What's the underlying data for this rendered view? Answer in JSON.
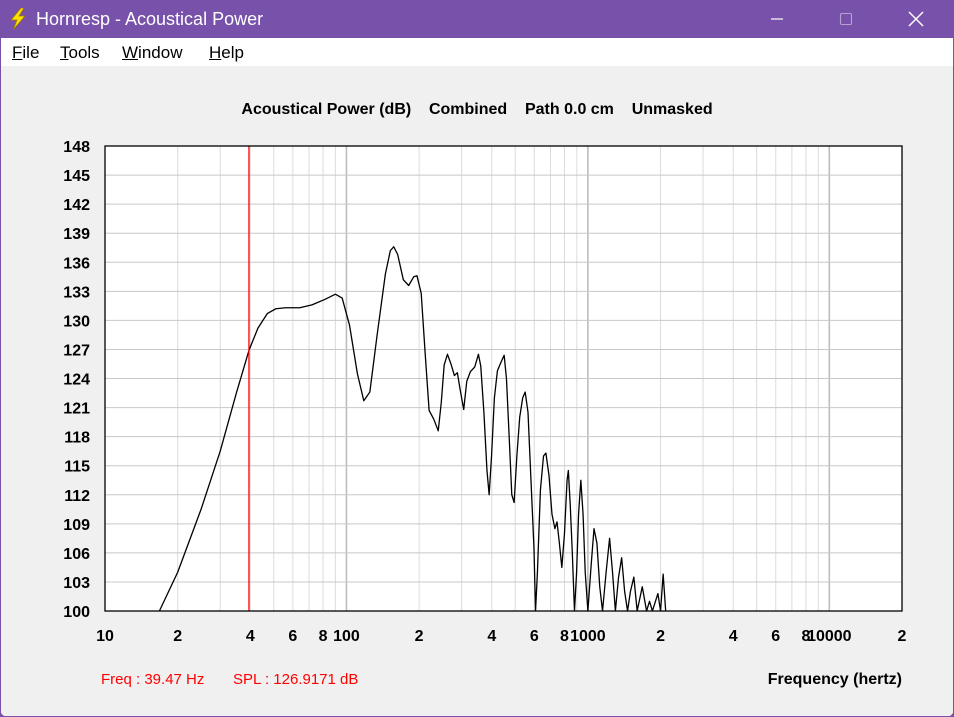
{
  "window": {
    "title": "Hornresp - Acoustical Power",
    "icon": "lightning-bolt-icon",
    "controls": [
      "minimize-icon",
      "maximize-icon",
      "close-icon"
    ]
  },
  "menu": [
    {
      "underline": "F",
      "rest": "ile"
    },
    {
      "underline": "T",
      "rest": "ools"
    },
    {
      "underline": "W",
      "rest": "indow"
    },
    {
      "underline": "H",
      "rest": "elp"
    }
  ],
  "chart_data": {
    "type": "line",
    "title": "Acoustical Power (dB)    Combined    Path 0.0 cm    Unmasked",
    "xlabel": "Frequency (hertz)",
    "ylabel": "",
    "xscale": "log",
    "xlim": [
      10,
      20000
    ],
    "ylim": [
      100,
      148
    ],
    "yticks": [
      148,
      145,
      142,
      139,
      136,
      133,
      130,
      127,
      124,
      121,
      118,
      115,
      112,
      109,
      106,
      103,
      100
    ],
    "xtick_labels": [
      {
        "v": 10,
        "t": "10"
      },
      {
        "v": 20,
        "t": "2"
      },
      {
        "v": 40,
        "t": "4"
      },
      {
        "v": 60,
        "t": "6"
      },
      {
        "v": 80,
        "t": "8"
      },
      {
        "v": 100,
        "t": "100"
      },
      {
        "v": 200,
        "t": "2"
      },
      {
        "v": 400,
        "t": "4"
      },
      {
        "v": 600,
        "t": "6"
      },
      {
        "v": 800,
        "t": "8"
      },
      {
        "v": 1000,
        "t": "1000"
      },
      {
        "v": 2000,
        "t": "2"
      },
      {
        "v": 4000,
        "t": "4"
      },
      {
        "v": 6000,
        "t": "6"
      },
      {
        "v": 8000,
        "t": "8"
      },
      {
        "v": 10000,
        "t": "10000"
      },
      {
        "v": 20000,
        "t": "2"
      }
    ],
    "grid": true,
    "cursor": {
      "freq": 39.47,
      "freq_label": "Freq : 39.47 Hz",
      "spl_label": "SPL : 126.9171 dB",
      "color": "#ff0000"
    },
    "series": [
      {
        "color": "#000000",
        "points": [
          [
            16.8,
            100
          ],
          [
            20,
            104
          ],
          [
            25,
            110.5
          ],
          [
            30,
            116.5
          ],
          [
            35,
            122.5
          ],
          [
            39.47,
            126.9
          ],
          [
            43,
            129.2
          ],
          [
            47,
            130.7
          ],
          [
            51,
            131.2
          ],
          [
            56,
            131.3
          ],
          [
            64,
            131.3
          ],
          [
            72,
            131.6
          ],
          [
            82,
            132.2
          ],
          [
            90,
            132.7
          ],
          [
            96,
            132.3
          ],
          [
            103,
            129.5
          ],
          [
            111,
            124.5
          ],
          [
            118,
            121.7
          ],
          [
            125,
            122.6
          ],
          [
            134,
            128.5
          ],
          [
            145,
            134.8
          ],
          [
            152,
            137.2
          ],
          [
            157,
            137.6
          ],
          [
            163,
            136.8
          ],
          [
            172,
            134.2
          ],
          [
            181,
            133.6
          ],
          [
            190,
            134.5
          ],
          [
            196,
            134.6
          ],
          [
            204,
            132.8
          ],
          [
            212,
            126.5
          ],
          [
            220,
            120.7
          ],
          [
            230,
            119.8
          ],
          [
            240,
            118.6
          ],
          [
            247,
            121.5
          ],
          [
            254,
            125.4
          ],
          [
            262,
            126.5
          ],
          [
            271,
            125.5
          ],
          [
            280,
            124.3
          ],
          [
            288,
            124.6
          ],
          [
            296,
            122.8
          ],
          [
            306,
            120.8
          ],
          [
            315,
            123.7
          ],
          [
            326,
            124.7
          ],
          [
            340,
            125.2
          ],
          [
            352,
            126.5
          ],
          [
            360,
            125.3
          ],
          [
            371,
            120.5
          ],
          [
            382,
            114.5
          ],
          [
            390,
            112.0
          ],
          [
            399,
            116.0
          ],
          [
            410,
            122.0
          ],
          [
            422,
            124.8
          ],
          [
            437,
            125.7
          ],
          [
            450,
            126.4
          ],
          [
            460,
            124.0
          ],
          [
            472,
            118.0
          ],
          [
            484,
            112.0
          ],
          [
            495,
            111.2
          ],
          [
            508,
            116.0
          ],
          [
            522,
            120.0
          ],
          [
            537,
            122.0
          ],
          [
            550,
            122.6
          ],
          [
            565,
            120.5
          ],
          [
            580,
            114.0
          ],
          [
            598,
            106.5
          ],
          [
            607,
            100
          ],
          [
            618,
            104.0
          ],
          [
            636,
            112.5
          ],
          [
            655,
            116.0
          ],
          [
            670,
            116.3
          ],
          [
            690,
            114.0
          ],
          [
            710,
            110.0
          ],
          [
            730,
            108.5
          ],
          [
            745,
            109.2
          ],
          [
            762,
            107.0
          ],
          [
            780,
            104.5
          ],
          [
            800,
            108.0
          ],
          [
            820,
            113.5
          ],
          [
            830,
            114.5
          ],
          [
            845,
            111.0
          ],
          [
            862,
            106.0
          ],
          [
            880,
            100
          ],
          [
            898,
            104.0
          ],
          [
            915,
            110.0
          ],
          [
            935,
            113.5
          ],
          [
            955,
            110.0
          ],
          [
            975,
            104.0
          ],
          [
            1000,
            100
          ],
          [
            1030,
            104.5
          ],
          [
            1060,
            108.5
          ],
          [
            1090,
            107.0
          ],
          [
            1120,
            102.5
          ],
          [
            1150,
            100
          ],
          [
            1190,
            104.0
          ],
          [
            1230,
            107.5
          ],
          [
            1265,
            104.0
          ],
          [
            1300,
            100
          ],
          [
            1340,
            103.5
          ],
          [
            1380,
            105.5
          ],
          [
            1420,
            102.0
          ],
          [
            1460,
            100
          ],
          [
            1500,
            102.0
          ],
          [
            1550,
            103.5
          ],
          [
            1600,
            100
          ],
          [
            1680,
            102.5
          ],
          [
            1750,
            100
          ],
          [
            1800,
            101.0
          ],
          [
            1850,
            100
          ],
          [
            1950,
            101.8
          ],
          [
            2000,
            100
          ],
          [
            2050,
            103.8
          ],
          [
            2100,
            100
          ]
        ]
      }
    ]
  }
}
